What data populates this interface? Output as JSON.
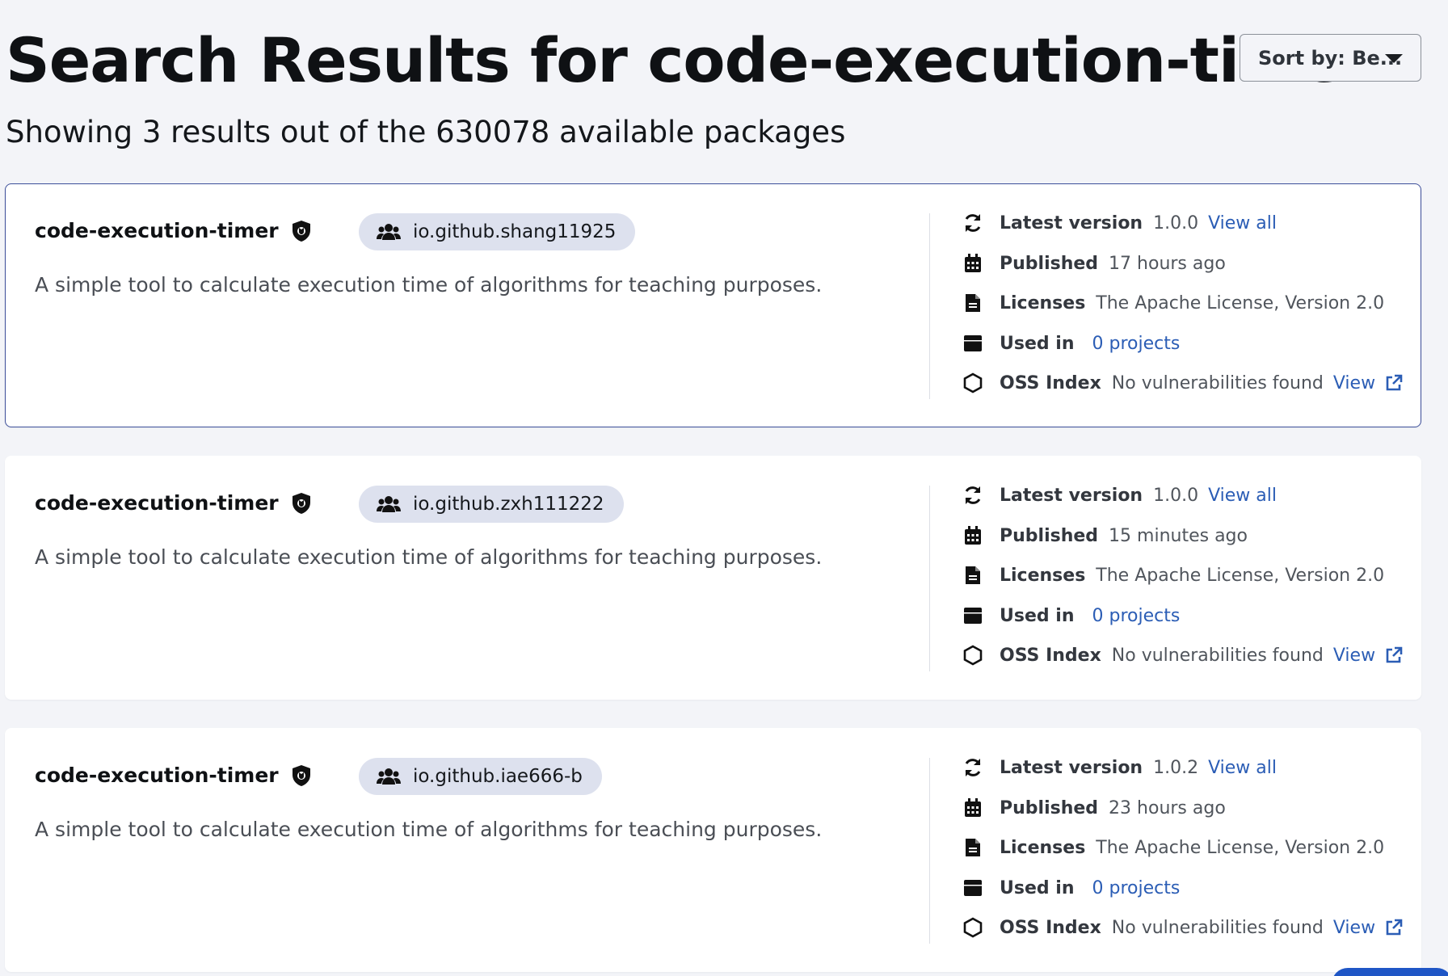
{
  "page": {
    "title": "Search Results for code-execution-timer",
    "summary": "Showing 3 results out of the 630078 available packages"
  },
  "sort": {
    "label": "Sort by: Be..."
  },
  "labels": {
    "latest_version": "Latest version",
    "view_all": "View all",
    "published": "Published",
    "licenses": "Licenses",
    "used_in": "Used in",
    "oss_index": "OSS Index",
    "view": "View"
  },
  "results": [
    {
      "name": "code-execution-timer",
      "group": "io.github.shang11925",
      "description": "A simple tool to calculate execution time of algorithms for teaching purposes.",
      "latest_version": "1.0.0",
      "published": "17 hours ago",
      "license": "The Apache License, Version 2.0",
      "used_in": "0 projects",
      "oss_status": "No vulnerabilities found"
    },
    {
      "name": "code-execution-timer",
      "group": "io.github.zxh111222",
      "description": "A simple tool to calculate execution time of algorithms for teaching purposes.",
      "latest_version": "1.0.0",
      "published": "15 minutes ago",
      "license": "The Apache License, Version 2.0",
      "used_in": "0 projects",
      "oss_status": "No vulnerabilities found"
    },
    {
      "name": "code-execution-timer",
      "group": "io.github.iae666-b",
      "description": "A simple tool to calculate execution time of algorithms for teaching purposes.",
      "latest_version": "1.0.2",
      "published": "23 hours ago",
      "license": "The Apache License, Version 2.0",
      "used_in": "0 projects",
      "oss_status": "No vulnerabilities found"
    }
  ],
  "colors": {
    "background": "#f3f4f8",
    "card": "#ffffff",
    "selected_border": "#3d4f9a",
    "chip": "#dde1ee",
    "link": "#2b5db5"
  },
  "icons": [
    "shield-icon",
    "users-icon",
    "refresh-icon",
    "calendar-icon",
    "file-icon",
    "box-icon",
    "hexagon-icon",
    "external-link-icon",
    "caret-down-icon"
  ]
}
